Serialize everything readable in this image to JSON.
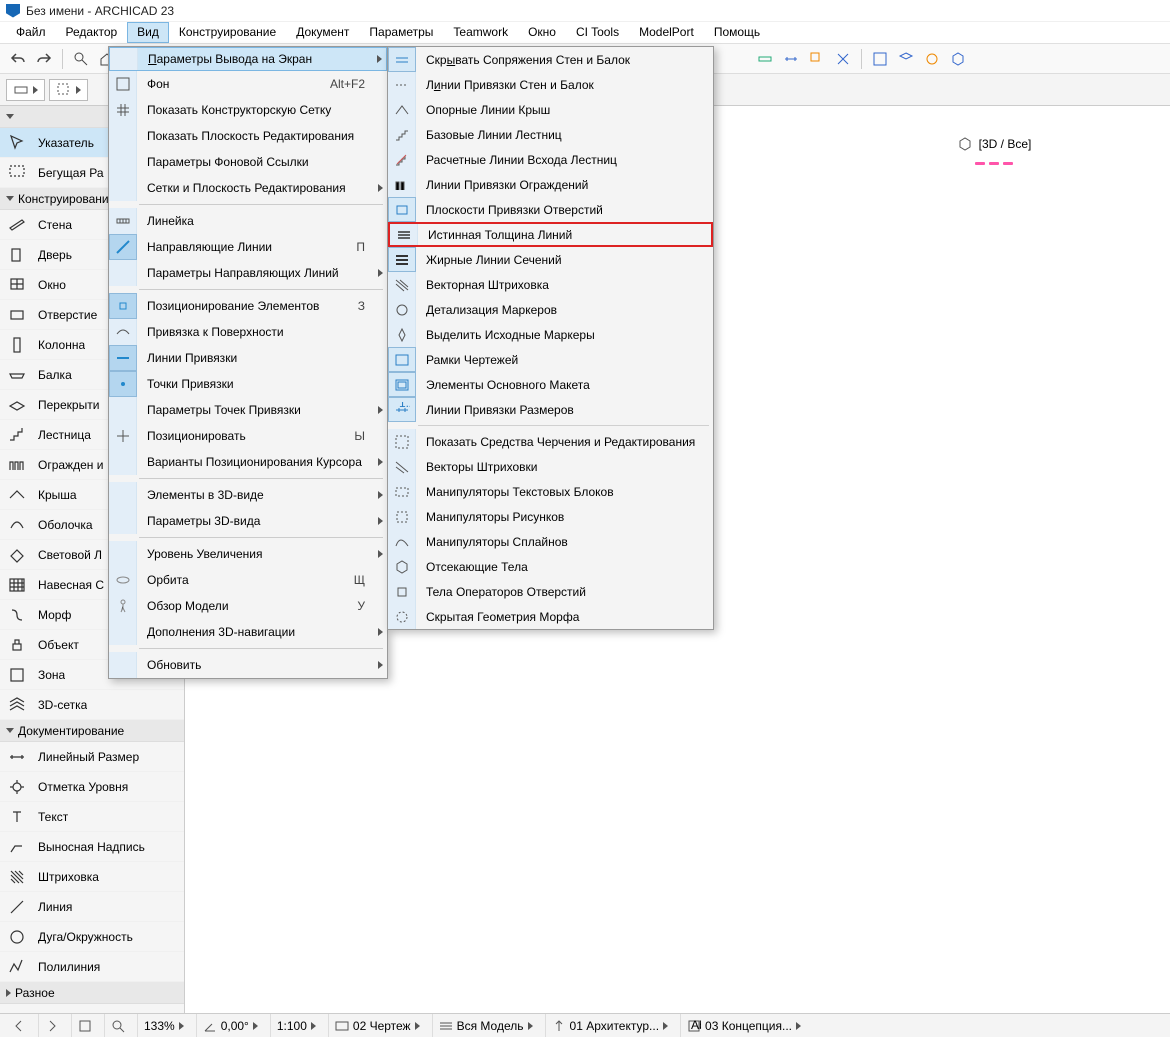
{
  "title": "Без имени - ARCHICAD 23",
  "menubar": [
    "Файл",
    "Редактор",
    "Вид",
    "Конструирование",
    "Документ",
    "Параметры",
    "Teamwork",
    "Окно",
    "CI Tools",
    "ModelPort",
    "Помощь"
  ],
  "menubar_active": 2,
  "toolbox": {
    "sel_header": "",
    "pointer": "Указатель",
    "marquee": "Бегущая Ра",
    "cat_construct": "Конструирование",
    "items_construct": [
      "Стена",
      "Дверь",
      "Окно",
      "Отверстие",
      "Колонна",
      "Балка",
      "Перекрыти",
      "Лестница",
      "Огражден и",
      "Крыша",
      "Оболочка",
      "Световой Л",
      "Навесная С",
      "Морф",
      "Объект",
      "Зона",
      "3D-сетка"
    ],
    "cat_document": "Документирование",
    "items_document": [
      "Линейный Размер",
      "Отметка Уровня",
      "Текст",
      "Выносная Надпись",
      "Штриховка",
      "Линия",
      "Дуга/Окружность",
      "Полилиния"
    ],
    "cat_misc": "Разное"
  },
  "viewmenu": [
    {
      "label": "Параметры Вывода на Экран",
      "arrow": true,
      "hl": true
    },
    {
      "label": "Фон",
      "sc": "Alt+F2",
      "icon": "bg"
    },
    {
      "label": "Показать Конструкторскую Сетку",
      "icon": "grid"
    },
    {
      "label": "Показать Плоскость Редактирования"
    },
    {
      "label": "Параметры Фоновой Ссылки"
    },
    {
      "label": "Сетки и Плоскость Редактирования",
      "arrow": true
    },
    {
      "sep": true
    },
    {
      "label": "Линейка",
      "icon": "ruler"
    },
    {
      "label": "Направляющие Линии",
      "sc": "П",
      "icon": "guide",
      "iconon": true
    },
    {
      "label": "Параметры Направляющих Линий",
      "arrow": true
    },
    {
      "sep": true
    },
    {
      "label": "Позиционирование Элементов",
      "sc": "З",
      "icon": "snap",
      "iconon": true
    },
    {
      "label": "Привязка к Поверхности",
      "icon": "surf"
    },
    {
      "label": "Линии Привязки",
      "icon": "sline",
      "iconon": true
    },
    {
      "label": "Точки Привязки",
      "icon": "spoint",
      "iconon": true
    },
    {
      "label": "Параметры Точек Привязки",
      "arrow": true
    },
    {
      "label": "Позиционировать",
      "sc": "Ы",
      "icon": "pos"
    },
    {
      "label": "Варианты Позиционирования Курсора",
      "arrow": true
    },
    {
      "sep": true
    },
    {
      "label": "Элементы в 3D-виде",
      "arrow": true
    },
    {
      "label": "Параметры 3D-вида",
      "arrow": true
    },
    {
      "sep": true
    },
    {
      "label": "Уровень Увеличения",
      "arrow": true
    },
    {
      "label": "Орбита",
      "sc": "Щ",
      "icon": "orbit",
      "disabled": true
    },
    {
      "label": "Обзор Модели",
      "sc": "У",
      "icon": "walk",
      "disabled": true
    },
    {
      "label": "Дополнения 3D-навигации",
      "arrow": true
    },
    {
      "sep": true
    },
    {
      "label": "Обновить",
      "arrow": true
    }
  ],
  "submenu": [
    {
      "label": "Скрывать Сопряжения Стен и Балок",
      "icon": "a",
      "on": true,
      "underline": "ы"
    },
    {
      "label": "Линии Привязки Стен и Балок",
      "icon": "b",
      "underline": "и"
    },
    {
      "label": "Опорные Линии Крыш",
      "icon": "c"
    },
    {
      "label": "Базовые Линии Лестниц",
      "icon": "d"
    },
    {
      "label": "Расчетные Линии Всхода Лестниц",
      "icon": "e"
    },
    {
      "label": "Линии Привязки Ограждений",
      "icon": "f"
    },
    {
      "label": "Плоскости Привязки Отверстий",
      "icon": "g",
      "on": true
    },
    {
      "label": "Истинная Толщина Линий",
      "icon": "h",
      "boxed": true
    },
    {
      "label": "Жирные Линии Сечений",
      "icon": "i",
      "on": true
    },
    {
      "label": "Векторная Штриховка",
      "icon": "j"
    },
    {
      "label": "Детализация Маркеров",
      "icon": "k"
    },
    {
      "label": "Выделить Исходные Маркеры",
      "icon": "l"
    },
    {
      "label": "Рамки Чертежей",
      "icon": "m",
      "on": true
    },
    {
      "label": "Элементы Основного Макета",
      "icon": "n",
      "on": true
    },
    {
      "label": "Линии Привязки Размеров",
      "icon": "o",
      "on": true
    },
    {
      "sep": true
    },
    {
      "label": "Показать Средства Черчения и Редактирования",
      "icon": "p"
    },
    {
      "label": "Векторы Штриховки",
      "icon": "q"
    },
    {
      "label": "Манипуляторы Текстовых Блоков",
      "icon": "r"
    },
    {
      "label": "Манипуляторы Рисунков",
      "icon": "s"
    },
    {
      "label": "Манипуляторы Сплайнов",
      "icon": "t"
    },
    {
      "label": "Отсекающие Тела",
      "icon": "u"
    },
    {
      "label": "Тела Операторов Отверстий",
      "icon": "v"
    },
    {
      "label": "Скрытая Геометрия Морфа",
      "icon": "w"
    }
  ],
  "sidepanel": {
    "title": "[3D / Все]"
  },
  "statusbar": {
    "zoom": "133%",
    "angle": "0,00°",
    "scale": "1:100",
    "view": "02 Чертеж",
    "model": "Вся Модель",
    "arch": "01 Архитектур...",
    "concept": "03 Концепция..."
  }
}
